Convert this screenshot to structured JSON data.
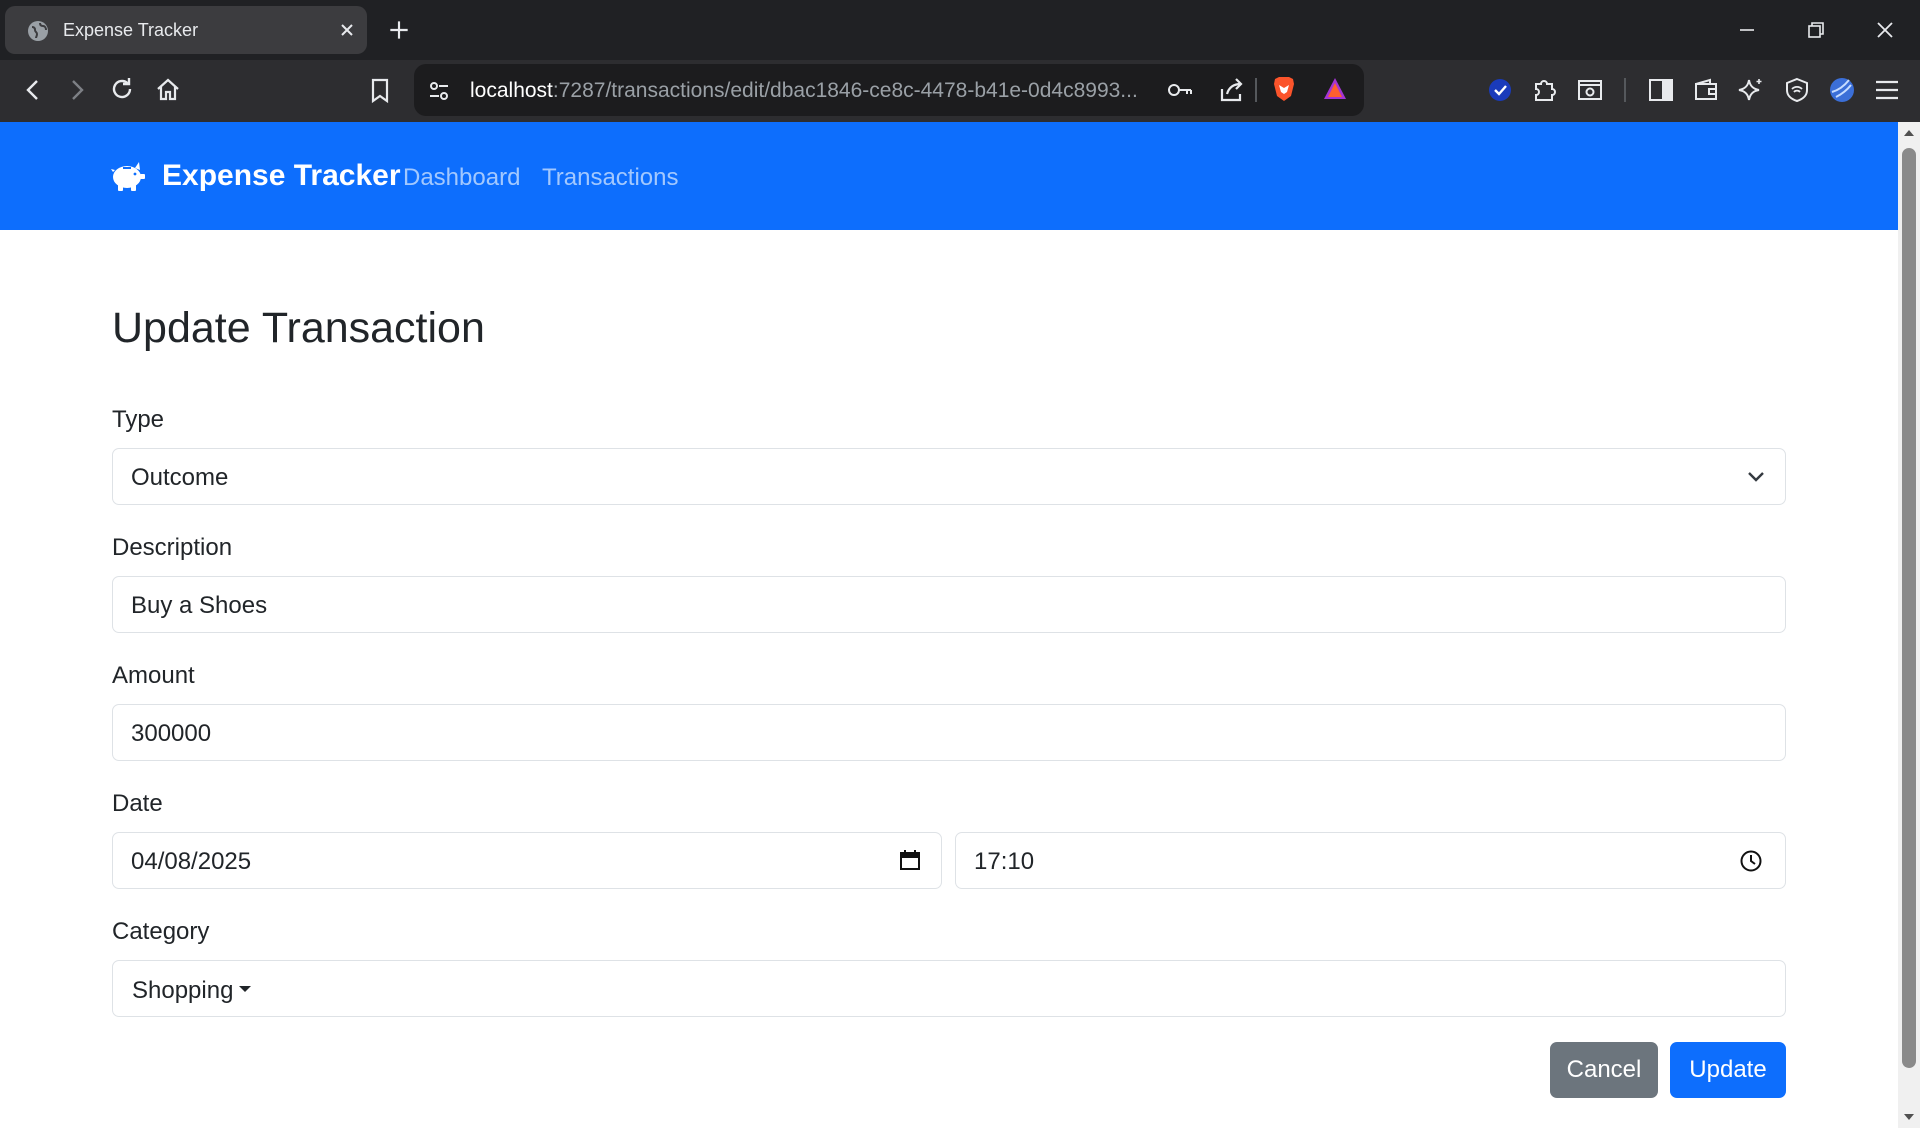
{
  "browser": {
    "tab_title": "Expense Tracker",
    "url_host": "localhost",
    "url_path": ":7287/transactions/edit/dbac1846-ce8c-4478-b41e-0d4c8993..."
  },
  "navbar": {
    "brand": "Expense Tracker",
    "links": [
      "Dashboard",
      "Transactions"
    ]
  },
  "form": {
    "title": "Update Transaction",
    "type": {
      "label": "Type",
      "value": "Outcome"
    },
    "description": {
      "label": "Description",
      "value": "Buy a Shoes"
    },
    "amount": {
      "label": "Amount",
      "value": "300000"
    },
    "date": {
      "label": "Date",
      "date_value": "04/08/2025",
      "time_value": "17:10"
    },
    "category": {
      "label": "Category",
      "value": "Shopping"
    },
    "cancel_label": "Cancel",
    "update_label": "Update"
  },
  "colors": {
    "primary": "#0d6efd",
    "secondary": "#6c757d",
    "border": "#dee2e6",
    "text": "#212529"
  }
}
